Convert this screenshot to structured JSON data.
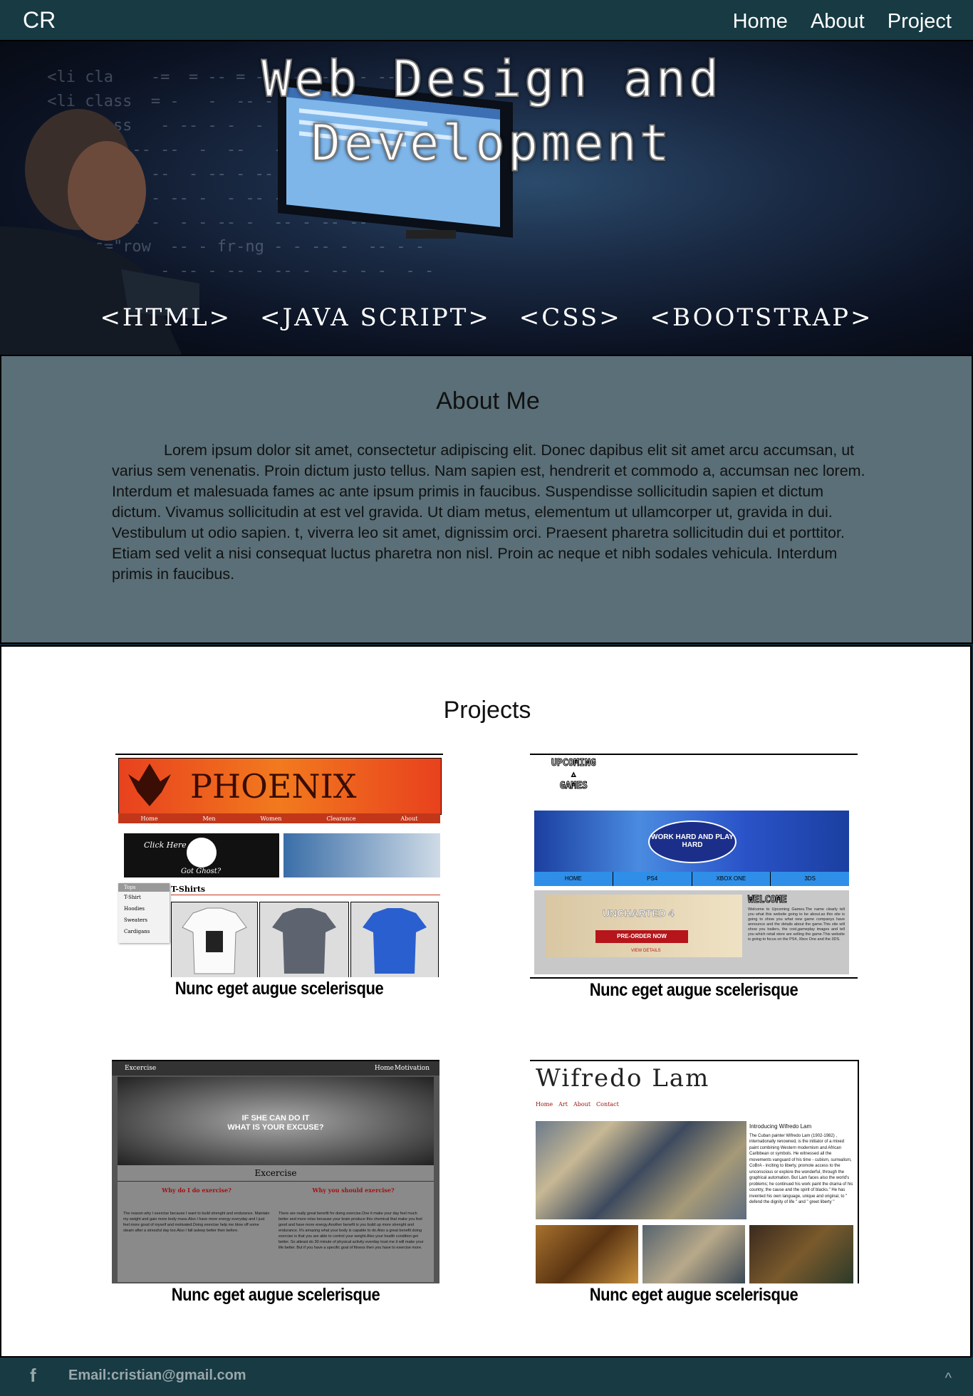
{
  "nav": {
    "logo": "CR",
    "links": [
      "Home",
      "About",
      "Project"
    ]
  },
  "hero": {
    "title_line1": "Web Design and",
    "title_line2": "Development",
    "tags": [
      "<HTML>",
      "<JAVA SCRIPT>",
      "<CSS>",
      "<BOOTSTRAP>"
    ]
  },
  "about": {
    "heading": "About Me",
    "text": "Lorem ipsum dolor sit amet, consectetur adipiscing elit. Donec dapibus elit sit amet arcu accumsan, ut varius sem venenatis. Proin dictum justo tellus. Nam sapien est, hendrerit et commodo a, accumsan nec lorem. Interdum et malesuada fames ac ante ipsum primis in faucibus. Suspendisse sollicitudin sapien et dictum dictum. Vivamus sollicitudin at est vel gravida. Ut diam metus, elementum ut ullamcorper ut, gravida in dui. Vestibulum ut odio sapien. t, viverra leo sit amet, dignissim orci. Praesent pharetra sollicitudin dui et porttitor. Etiam sed velit a nisi consequat luctus pharetra non nisl. Proin ac neque et nibh sodales vehicula. Interdum  primis in faucibus."
  },
  "projects": {
    "heading": "Projects",
    "items": [
      {
        "caption": "Nunc eget augue scelerisque",
        "brand": "PHOENIX",
        "menu": [
          "Home",
          "Men",
          "Women",
          "Clearance",
          "About"
        ],
        "banner_top": "Click Here",
        "banner_bottom": "Got Ghost?",
        "section": "T-Shirts",
        "sidebar": [
          "Tops",
          "T-Shirt",
          "Hoodies",
          "Sweaters",
          "Cardigans"
        ]
      },
      {
        "caption": "Nunc eget augue scelerisque",
        "logo_top": "UPCOMING",
        "logo_bottom": "GAMES",
        "banner": "WORK HARD AND PLAY HARD",
        "menu": [
          "HOME",
          "PS4",
          "XBOX ONE",
          "3DS"
        ],
        "promo_title": "UNCHARTED 4",
        "promo_sub": "PRE-ORDER NOW",
        "promo_details": "VIEW DETAILS",
        "welcome": "WELCOME",
        "welcome_text": "Welcome to Upcoming Games.The name clearly tell you what this website going to be about.as this site is going to show you what new game companys have announce and the details about the game.This site will show you trailers, the cost,gameplay images and tell you which retail store are selling the game.This website is going to focus on the PS4, Xbox One and the 3DS."
      },
      {
        "caption": "Nunc eget augue scelerisque",
        "site_name": "Excercise",
        "menu": [
          "Home",
          "Motivation"
        ],
        "hero_line1": "IF SHE CAN DO IT",
        "hero_line2": "WHAT IS YOUR EXCUSE?",
        "section": "Excercise",
        "col1_title": "Why do I do exercise?",
        "col2_title": "Why you should exercise?",
        "col1_text": "The reason why I exercise because I want to build strenght and endurance. Maintain my weight and gain more body mass.Also I have more energy everyday and I just feel more good of myself and motivated.Doing exercise help me blow off some steam after a stressful day too.Also I fall asleep better then before.",
        "col2_text": "There are really great benefit for doing exercise.One it make your day feel much better and more relax because your brain produce this chemical that make you feel good and have more energy.Another benefit is you build up more strenght and endurance. It's amazing what your body is capable to do.Also a great benefit doing exercise is that you are able to control your weight.Also your health condition get better. So atleast do 30 minute of physical activity everday trust me it will make your life better. But if you have a specific goal of fitness then you have to exercise more."
      },
      {
        "caption": "Nunc eget augue scelerisque",
        "site_name": "Wifredo Lam",
        "menu": [
          "Home",
          "Art",
          "About",
          "Contact"
        ],
        "intro_title": "Introducing Wifredo Lam",
        "intro_text": "The Cuban painter Wifredo Lam (1902-1982) , internationally renowned, is the initiator of a mixed paint combining Western modernism and African Caribbean or symbols. He witnessed all the movements vanguard of his time - cubism, surrealism, CoBrA - inciting to liberty, promote access to the unconscious or explore the wonderful, through the graphical automation. But Lam faces also the world's problems; he continued his work paint the drama of his country, the cause and the spirit of blacks.\" He has invented his own language, unique and original, to \" defend the dignity of life \" and \" greet liberty \""
      }
    ]
  },
  "footer": {
    "facebook": "f",
    "email": "Email:cristian@gmail.com",
    "up": "^"
  },
  "colors": {
    "nav_bg": "#173a43",
    "about_bg": "#5a6f77",
    "footer_bg": "#173a43"
  }
}
